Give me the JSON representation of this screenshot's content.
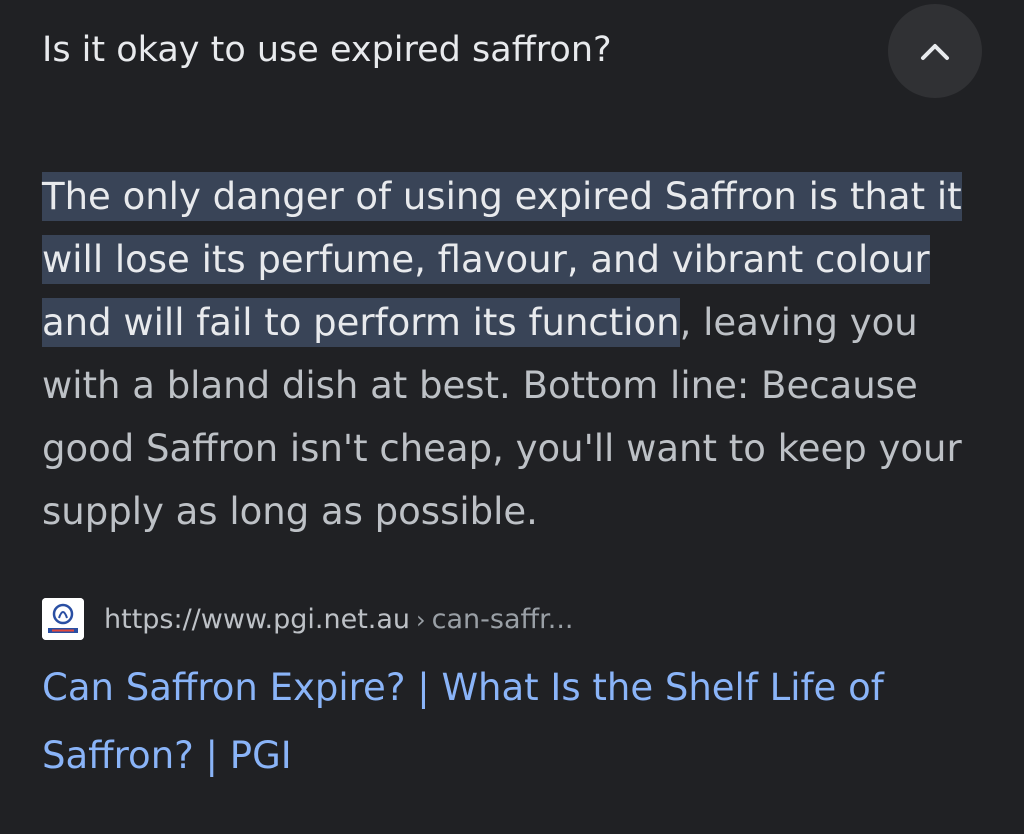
{
  "faq": {
    "question": "Is it okay to use expired saffron?",
    "toggle_icon": "chevron-up-icon"
  },
  "answer": {
    "highlighted": "The only danger of using expired Saffron is that it will lose its perfume, flavour, and vibrant colour and will fail to perform its function",
    "rest": ", leaving you with a bland dish at best. Bottom line: Because good Saffron isn't cheap, you'll want to keep your supply as long as possible."
  },
  "source": {
    "favicon": "pgi-logo-icon",
    "url": "https://www.pgi.net.au",
    "separator": "›",
    "path": "can-saffr..."
  },
  "result": {
    "title": "Can Saffron Expire? | What Is the Shelf Life of Saffron? | PGI"
  },
  "colors": {
    "background": "#202124",
    "highlight": "#394457",
    "link": "#8ab4f8"
  }
}
